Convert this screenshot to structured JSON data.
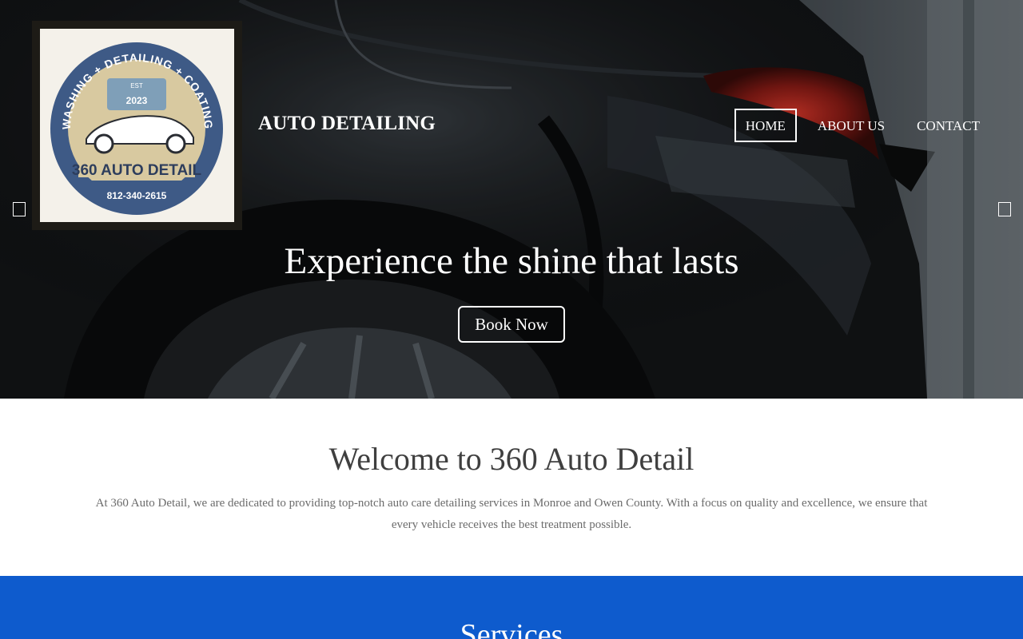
{
  "brand": {
    "logo_top_text": "WASHING + DETAILING + COATING",
    "logo_est": "EST",
    "logo_year": "2023",
    "logo_name": "360 AUTO DETAIL",
    "logo_phone": "812-340-2615",
    "site_title": "AUTO DETAILING"
  },
  "nav": {
    "items": [
      {
        "label": "HOME",
        "active": true
      },
      {
        "label": "ABOUT US",
        "active": false
      },
      {
        "label": "CONTACT",
        "active": false
      }
    ]
  },
  "hero": {
    "headline": "Experience the shine that lasts",
    "cta_label": "Book Now",
    "prev_icon": "prev-slide-icon",
    "next_icon": "next-slide-icon"
  },
  "welcome": {
    "title": "Welcome to 360 Auto Detail",
    "text": "At 360 Auto Detail, we are dedicated to providing top-notch auto care detailing services in Monroe and Owen County. With a focus on quality and excellence, we ensure that every vehicle receives the best treatment possible."
  },
  "services": {
    "title": "Services"
  },
  "colors": {
    "services_bg": "#0e5bcd",
    "logo_ring": "#3e5a86",
    "logo_band": "#d8c9a0"
  }
}
